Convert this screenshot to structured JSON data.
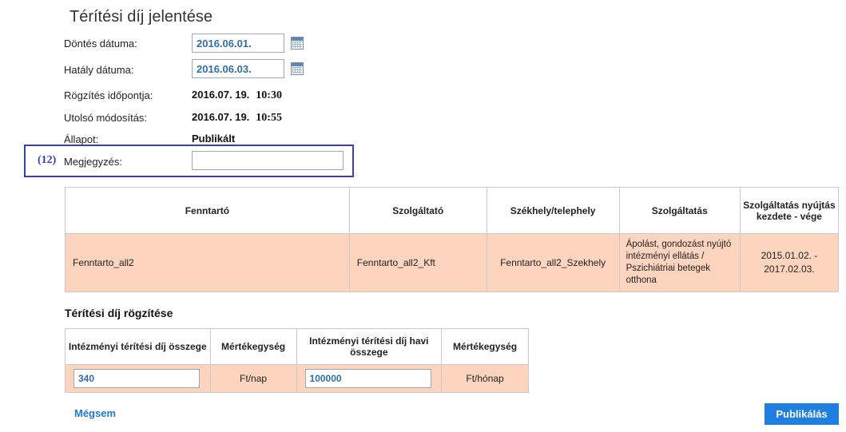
{
  "page": {
    "title": "Térítési díj jelentése"
  },
  "form": {
    "decision_date": {
      "label": "Döntés dátuma:",
      "value": "2016.06.01."
    },
    "effective_date": {
      "label": "Hatály dátuma:",
      "value": "2016.06.03."
    },
    "recorded_at": {
      "label": "Rögzítés időpontja:",
      "date": "2016.07. 19.",
      "time": "10:30"
    },
    "last_modified": {
      "label": "Utolsó módosítás:",
      "date": "2016.07. 19.",
      "time": "10:55"
    },
    "status": {
      "label": "Állapot:",
      "value": "Publikált"
    },
    "note": {
      "tag": "(12)",
      "label": "Megjegyzés:",
      "value": ""
    }
  },
  "provider_table": {
    "headers": [
      "Fenntartó",
      "Szolgáltató",
      "Székhely/telephely",
      "Szolgáltatás",
      "Szolgáltatás nyújtás kezdete - vége"
    ],
    "row": [
      "Fenntarto_all2",
      "Fenntarto_all2_Kft",
      "Fenntarto_all2_Szekhely",
      "Ápolást, gondozást nyújtó intézményi ellátás / Pszichiátriai betegek otthona",
      "2015.01.02. - 2017.02.03."
    ]
  },
  "fee_section": {
    "title": "Térítési díj rögzítése",
    "headers": [
      "Intézményi térítési díj összege",
      "Mértékegység",
      "Intézményi térítési díj havi összege",
      "Mértékegység"
    ],
    "daily_amount": "340",
    "daily_unit": "Ft/nap",
    "monthly_amount": "100000",
    "monthly_unit": "Ft/hónap"
  },
  "actions": {
    "cancel": "Mégsem",
    "publish": "Publikálás"
  },
  "colors": {
    "accent": "#1f7fe0",
    "row_highlight": "#fdd5be",
    "frame": "#3a3fa8"
  }
}
